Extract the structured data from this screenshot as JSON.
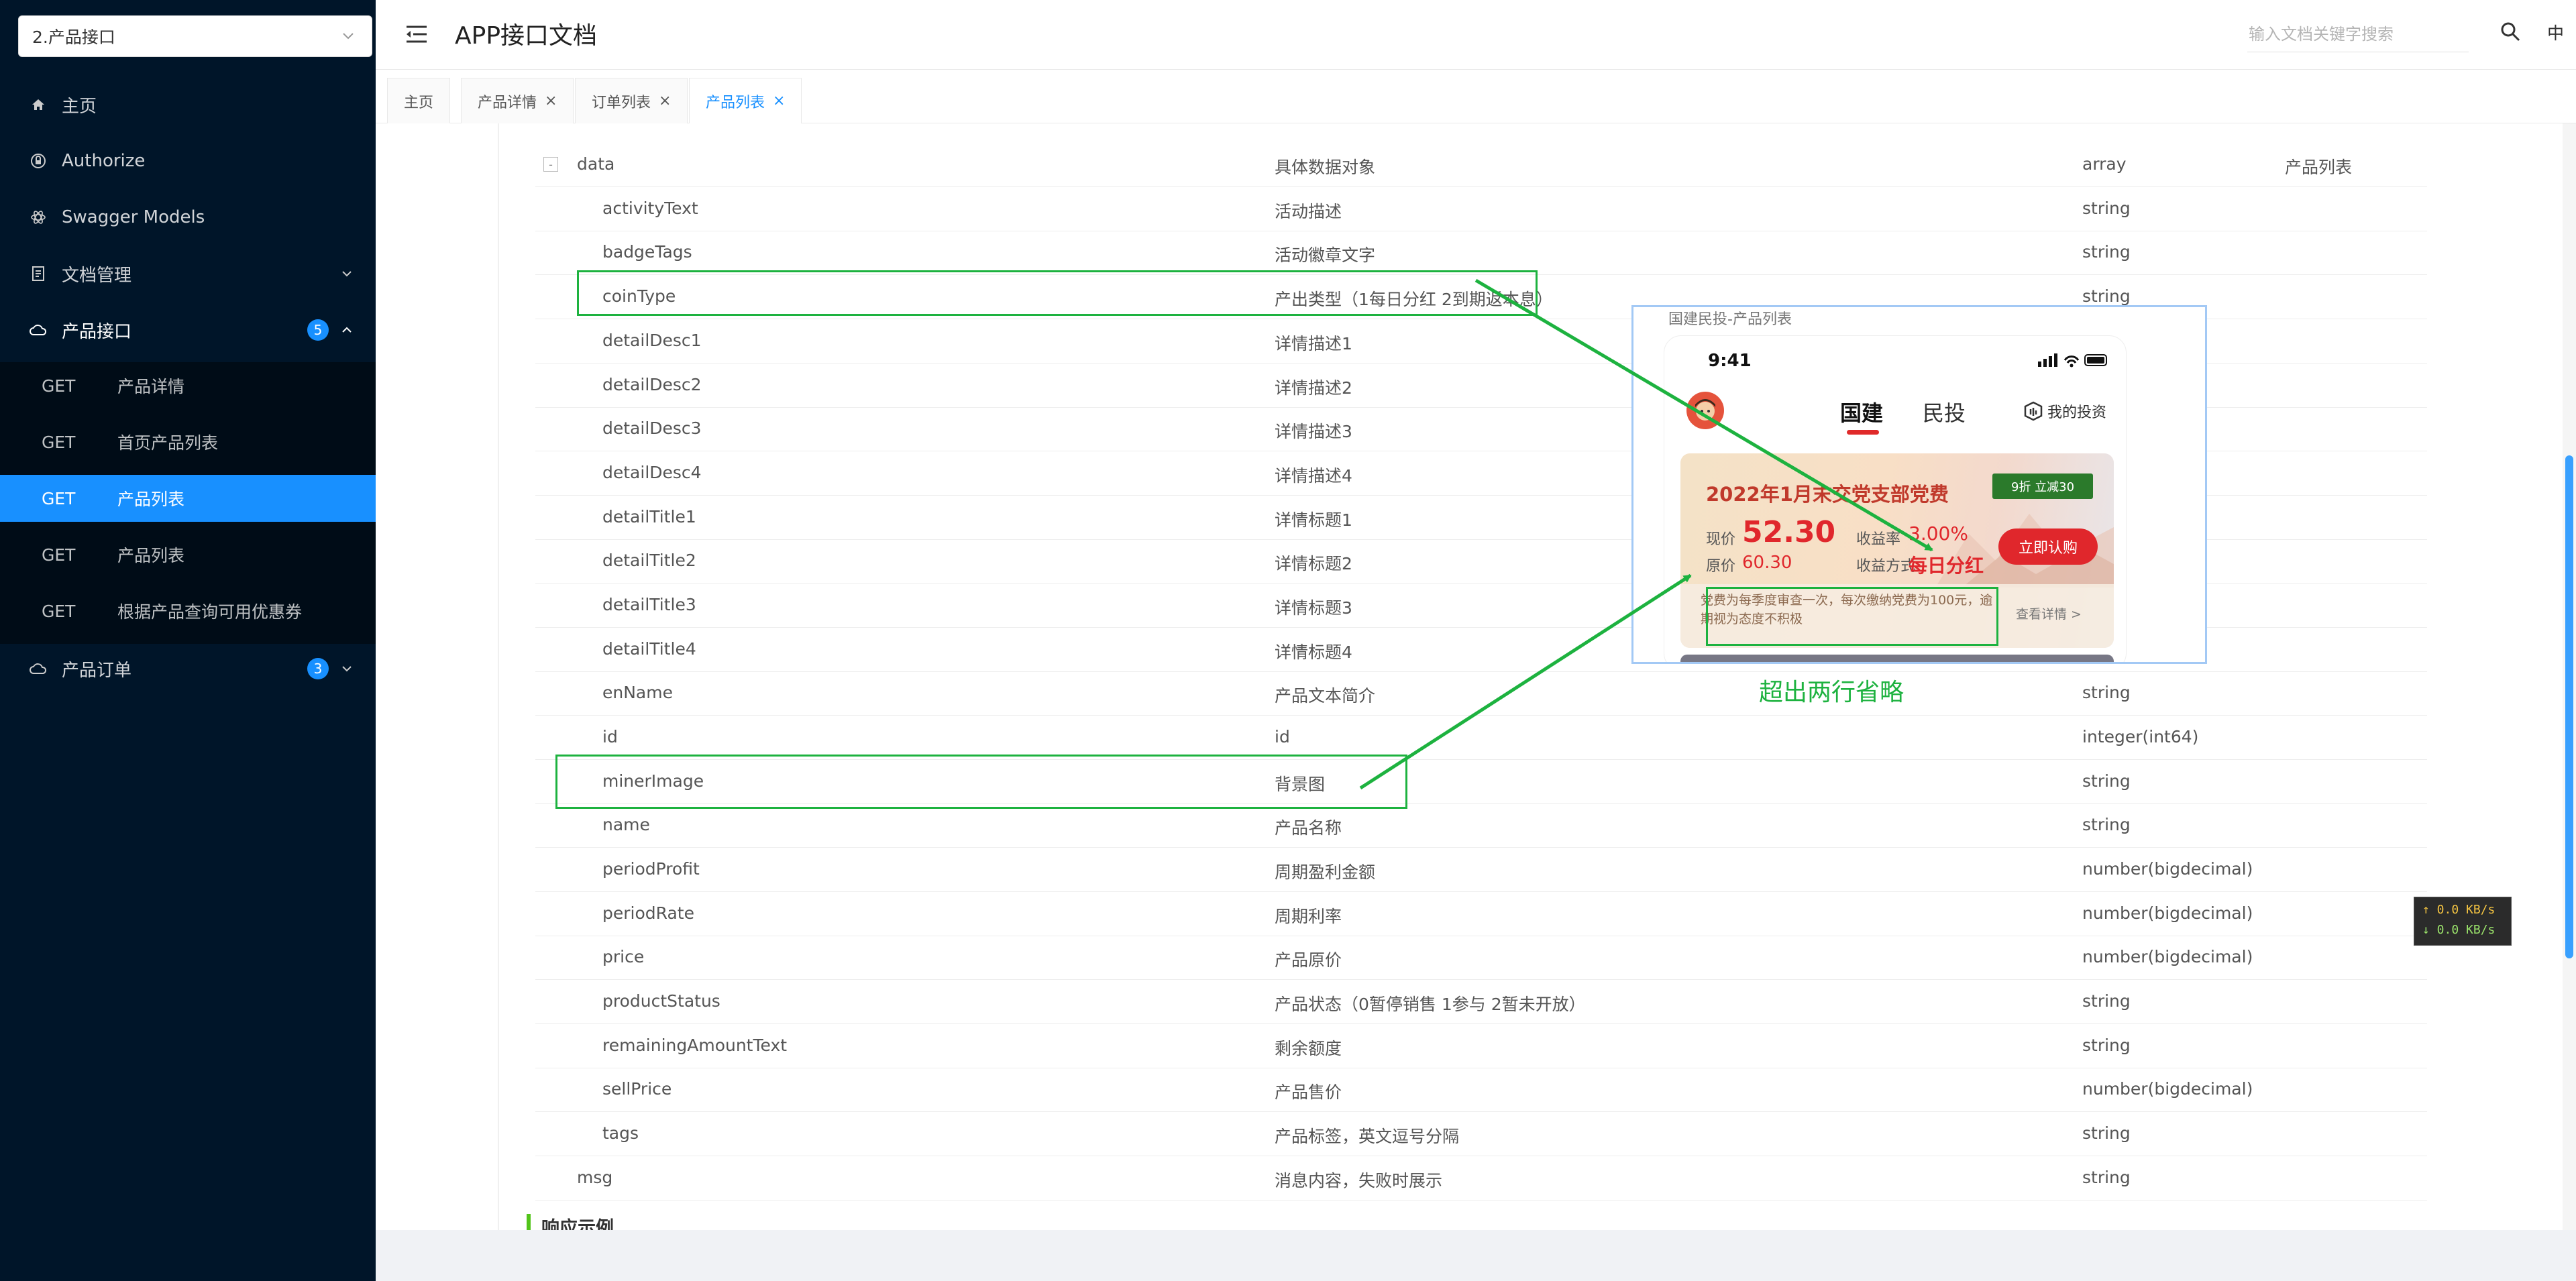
{
  "sidebar": {
    "group_select": "2.产品接口",
    "items": [
      {
        "label": "主页"
      },
      {
        "label": "Authorize"
      },
      {
        "label": "Swagger Models"
      },
      {
        "label": "文档管理"
      },
      {
        "label": "产品接口",
        "badge": "5"
      },
      {
        "label": "产品订单",
        "badge": "3"
      }
    ],
    "product_endpoints": [
      {
        "method": "GET",
        "name": "产品详情"
      },
      {
        "method": "GET",
        "name": "首页产品列表"
      },
      {
        "method": "GET",
        "name": "产品列表",
        "active": true
      },
      {
        "method": "GET",
        "name": "产品列表"
      },
      {
        "method": "GET",
        "name": "根据产品查询可用优惠券"
      }
    ]
  },
  "header": {
    "title": "APP接口文档",
    "search_placeholder": "输入文档关键字搜索",
    "lang": "中"
  },
  "tabs": [
    {
      "label": "主页"
    },
    {
      "label": "产品详情"
    },
    {
      "label": "订单列表"
    },
    {
      "label": "产品列表",
      "active": true
    }
  ],
  "params": {
    "data_row": {
      "toggle": "-",
      "name": "data",
      "desc": "具体数据对象",
      "type": "array",
      "schema": "产品列表"
    },
    "fields": [
      {
        "name": "activityText",
        "desc": "活动描述",
        "type": "string"
      },
      {
        "name": "badgeTags",
        "desc": "活动徽章文字",
        "type": "string"
      },
      {
        "name": "coinType",
        "desc": "产出类型（1每日分红 2到期返本息）",
        "type": "string"
      },
      {
        "name": "detailDesc1",
        "desc": "详情描述1",
        "type": ""
      },
      {
        "name": "detailDesc2",
        "desc": "详情描述2",
        "type": ""
      },
      {
        "name": "detailDesc3",
        "desc": "详情描述3",
        "type": ""
      },
      {
        "name": "detailDesc4",
        "desc": "详情描述4",
        "type": ""
      },
      {
        "name": "detailTitle1",
        "desc": "详情标题1",
        "type": ""
      },
      {
        "name": "detailTitle2",
        "desc": "详情标题2",
        "type": ""
      },
      {
        "name": "detailTitle3",
        "desc": "详情标题3",
        "type": ""
      },
      {
        "name": "detailTitle4",
        "desc": "详情标题4",
        "type": ""
      },
      {
        "name": "enName",
        "desc": "产品文本简介",
        "type": "string"
      },
      {
        "name": "id",
        "desc": "id",
        "type": "integer(int64)"
      },
      {
        "name": "minerImage",
        "desc": "背景图",
        "type": "string"
      },
      {
        "name": "name",
        "desc": "产品名称",
        "type": "string"
      },
      {
        "name": "periodProfit",
        "desc": "周期盈利金额",
        "type": "number(bigdecimal)"
      },
      {
        "name": "periodRate",
        "desc": "周期利率",
        "type": "number(bigdecimal)"
      },
      {
        "name": "price",
        "desc": "产品原价",
        "type": "number(bigdecimal)"
      },
      {
        "name": "productStatus",
        "desc": "产品状态（0暂停销售 1参与 2暂未开放）",
        "type": "string"
      },
      {
        "name": "remainingAmountText",
        "desc": "剩余额度",
        "type": "string"
      },
      {
        "name": "sellPrice",
        "desc": "产品售价",
        "type": "number(bigdecimal)"
      },
      {
        "name": "tags",
        "desc": "产品标签，英文逗号分隔",
        "type": "string"
      }
    ],
    "msg_row": {
      "name": "msg",
      "desc": "消息内容，失败时展示",
      "type": "string"
    }
  },
  "section_heading": "响应示例",
  "annotation": {
    "label": "超出两行省略",
    "color": "#1db23f"
  },
  "preview": {
    "title": "国建民投-产品列表",
    "time": "9:41",
    "tab_active": "国建",
    "tab_other": "民投",
    "my_invest": "我的投资",
    "card": {
      "title": "2022年1月末交党支部党费",
      "promo": "9折 立减30",
      "current_label": "现价",
      "current_value": "52.30",
      "rate_label": "收益率",
      "rate_value": "3.00%",
      "original_label": "原价",
      "original_value": "60.30",
      "method_label": "收益方式",
      "method_value": "每日分红",
      "buy_button": "立即认购",
      "description": "党费为每季度审查一次，每次缴纳党费为100元，逾期视为态度不积极",
      "detail_link": "查看详情 >"
    }
  },
  "netspeed": {
    "up": "↑ 0.0 KB/s",
    "down": "↓ 0.0 KB/s"
  },
  "colors": {
    "sidebar_bg": "#001529",
    "submenu_bg": "#000c17",
    "accent": "#1890ff",
    "annotation_green": "#1db23f",
    "price_red": "#e0272c"
  }
}
